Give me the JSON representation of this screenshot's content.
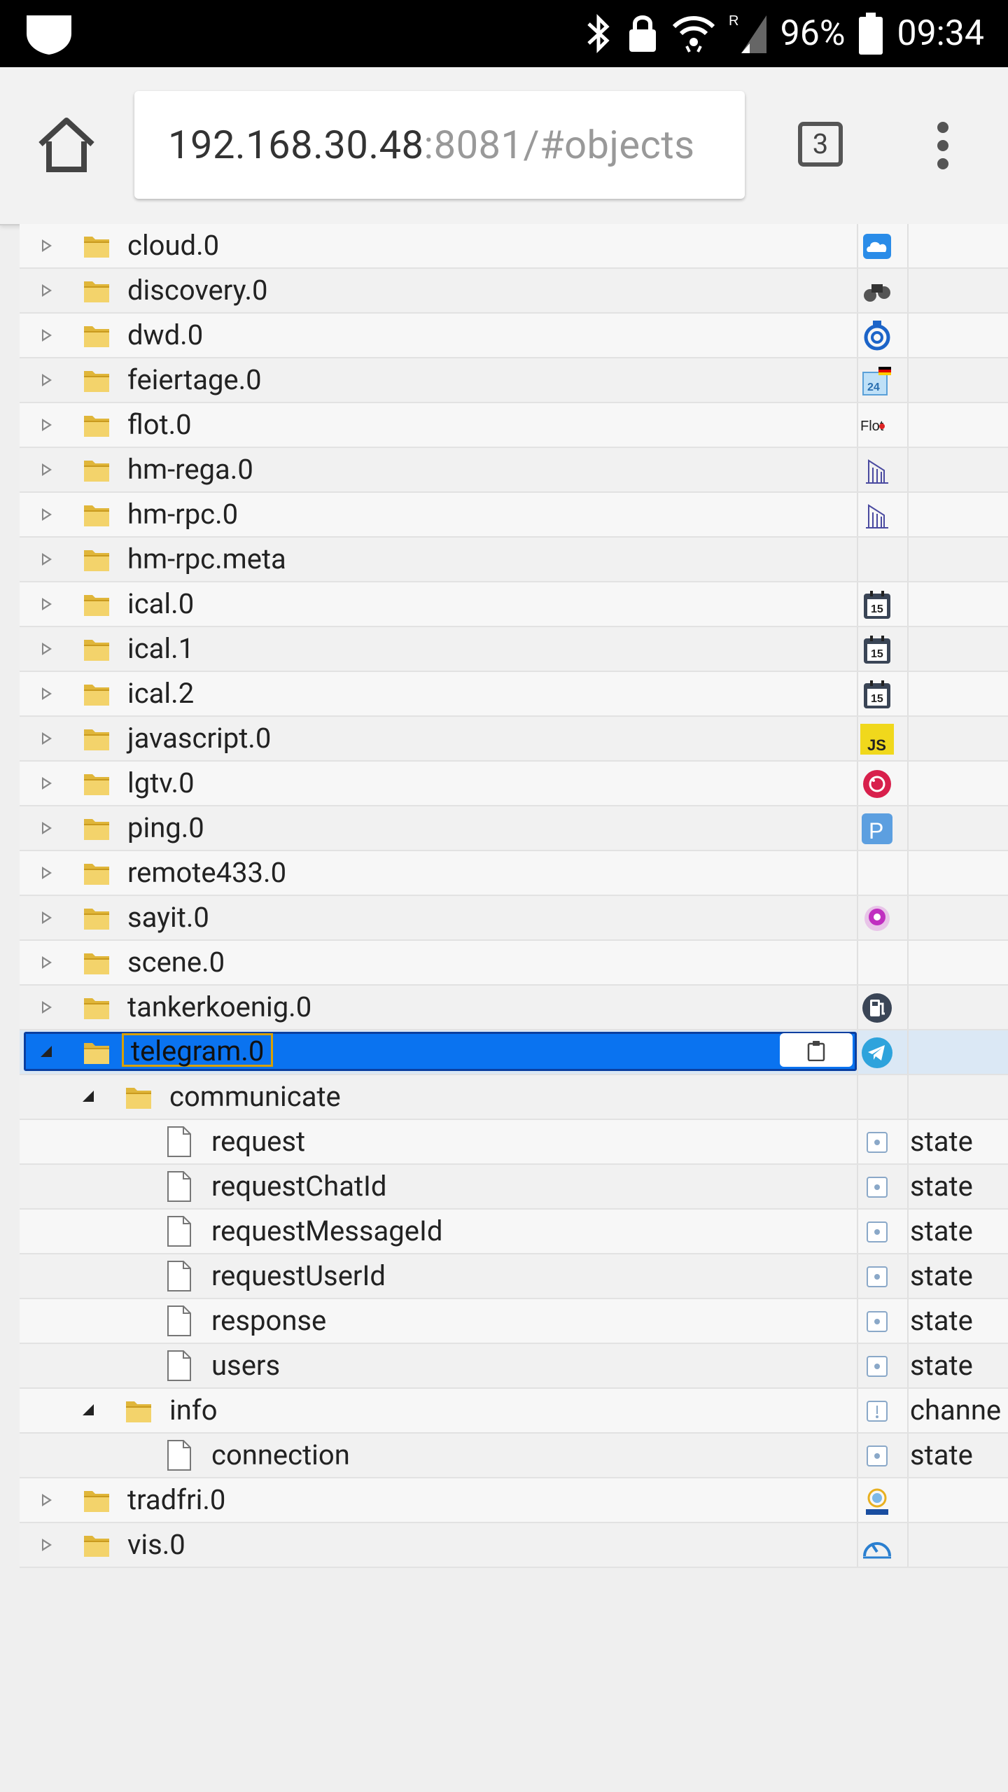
{
  "status_bar": {
    "battery": "96%",
    "time": "09:34",
    "network_label": "R"
  },
  "browser": {
    "url_host": "192.168.30.48",
    "url_rest": ":8081/#objects",
    "tab_count": "3"
  },
  "tree": {
    "rows": [
      {
        "name": "cloud.0",
        "level": 0,
        "kind": "folder",
        "expanded": false,
        "icon": "cloud-icon",
        "type": ""
      },
      {
        "name": "discovery.0",
        "level": 0,
        "kind": "folder",
        "expanded": false,
        "icon": "binoculars-icon",
        "type": ""
      },
      {
        "name": "dwd.0",
        "level": 0,
        "kind": "folder",
        "expanded": false,
        "icon": "dwd-icon",
        "type": ""
      },
      {
        "name": "feiertage.0",
        "level": 0,
        "kind": "folder",
        "expanded": false,
        "icon": "calendar-flag-icon",
        "type": ""
      },
      {
        "name": "flot.0",
        "level": 0,
        "kind": "folder",
        "expanded": false,
        "icon": "flot-icon",
        "type": ""
      },
      {
        "name": "hm-rega.0",
        "level": 0,
        "kind": "folder",
        "expanded": false,
        "icon": "homematic-icon",
        "type": ""
      },
      {
        "name": "hm-rpc.0",
        "level": 0,
        "kind": "folder",
        "expanded": false,
        "icon": "homematic-icon",
        "type": ""
      },
      {
        "name": "hm-rpc.meta",
        "level": 0,
        "kind": "folder",
        "expanded": false,
        "icon": "",
        "type": ""
      },
      {
        "name": "ical.0",
        "level": 0,
        "kind": "folder",
        "expanded": false,
        "icon": "calendar-icon",
        "type": ""
      },
      {
        "name": "ical.1",
        "level": 0,
        "kind": "folder",
        "expanded": false,
        "icon": "calendar-icon",
        "type": ""
      },
      {
        "name": "ical.2",
        "level": 0,
        "kind": "folder",
        "expanded": false,
        "icon": "calendar-icon",
        "type": ""
      },
      {
        "name": "javascript.0",
        "level": 0,
        "kind": "folder",
        "expanded": false,
        "icon": "js-icon",
        "type": ""
      },
      {
        "name": "lgtv.0",
        "level": 0,
        "kind": "folder",
        "expanded": false,
        "icon": "lg-icon",
        "type": ""
      },
      {
        "name": "ping.0",
        "level": 0,
        "kind": "folder",
        "expanded": false,
        "icon": "ping-icon",
        "type": ""
      },
      {
        "name": "remote433.0",
        "level": 0,
        "kind": "folder",
        "expanded": false,
        "icon": "",
        "type": ""
      },
      {
        "name": "sayit.0",
        "level": 0,
        "kind": "folder",
        "expanded": false,
        "icon": "sayit-icon",
        "type": ""
      },
      {
        "name": "scene.0",
        "level": 0,
        "kind": "folder",
        "expanded": false,
        "icon": "",
        "type": ""
      },
      {
        "name": "tankerkoenig.0",
        "level": 0,
        "kind": "folder",
        "expanded": false,
        "icon": "fuel-icon",
        "type": ""
      },
      {
        "name": "telegram.0",
        "level": 0,
        "kind": "folder",
        "expanded": true,
        "icon": "telegram-icon",
        "type": "",
        "selected": true
      },
      {
        "name": "communicate",
        "level": 1,
        "kind": "folder",
        "expanded": true,
        "icon": "",
        "type": ""
      },
      {
        "name": "request",
        "level": 2,
        "kind": "file",
        "icon": "state-icon",
        "type": "state"
      },
      {
        "name": "requestChatId",
        "level": 2,
        "kind": "file",
        "icon": "state-icon",
        "type": "state"
      },
      {
        "name": "requestMessageId",
        "level": 2,
        "kind": "file",
        "icon": "state-icon",
        "type": "state"
      },
      {
        "name": "requestUserId",
        "level": 2,
        "kind": "file",
        "icon": "state-icon",
        "type": "state"
      },
      {
        "name": "response",
        "level": 2,
        "kind": "file",
        "icon": "state-icon",
        "type": "state"
      },
      {
        "name": "users",
        "level": 2,
        "kind": "file",
        "icon": "state-icon",
        "type": "state"
      },
      {
        "name": "info",
        "level": 1,
        "kind": "folder",
        "expanded": true,
        "icon": "channel-icon",
        "type": "channe"
      },
      {
        "name": "connection",
        "level": 2,
        "kind": "file",
        "icon": "state-icon",
        "type": "state"
      },
      {
        "name": "tradfri.0",
        "level": 0,
        "kind": "folder",
        "expanded": false,
        "icon": "ikea-icon",
        "type": ""
      },
      {
        "name": "vis.0",
        "level": 0,
        "kind": "folder",
        "expanded": false,
        "icon": "gauge-icon",
        "type": ""
      }
    ]
  }
}
